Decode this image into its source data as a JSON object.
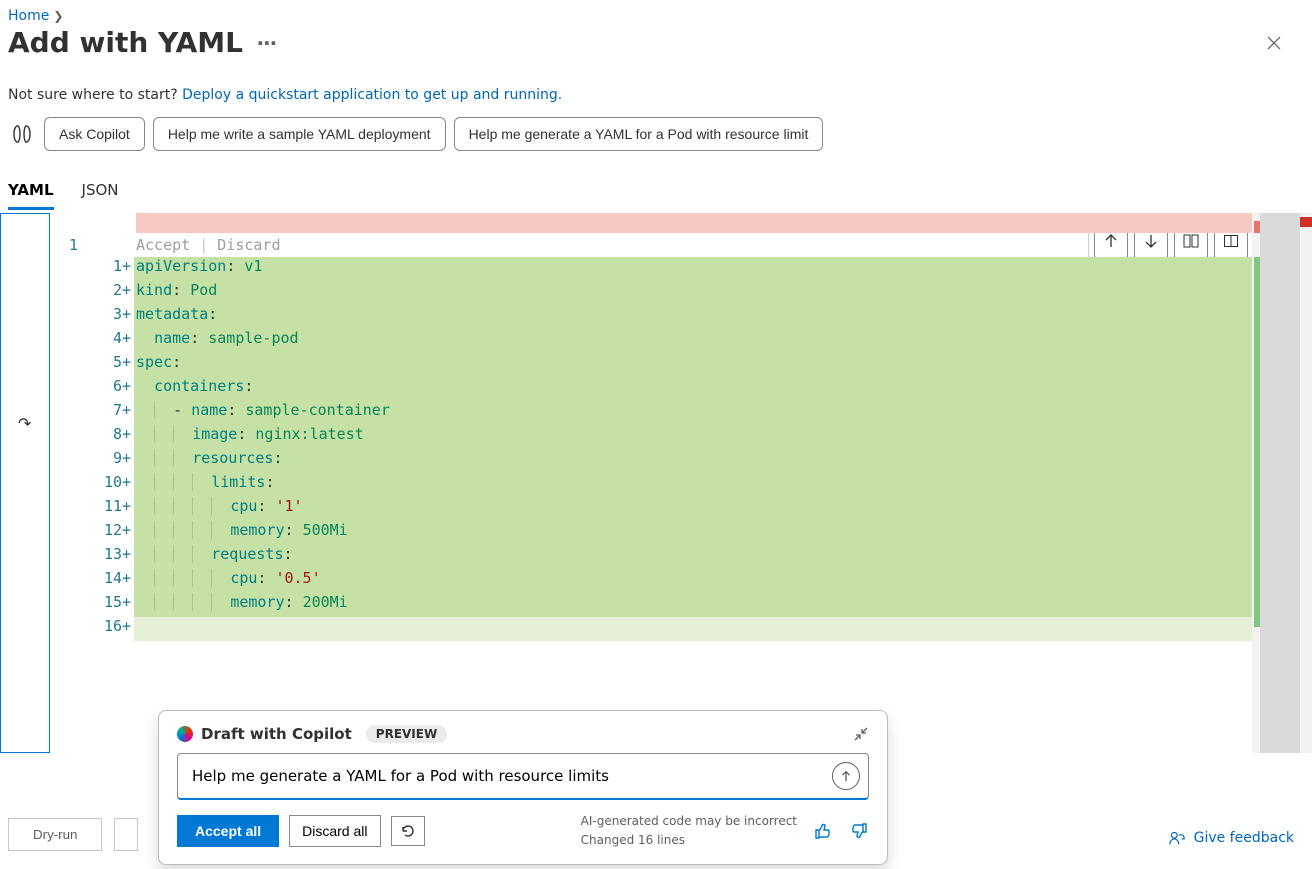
{
  "breadcrumb": {
    "home": "Home"
  },
  "page": {
    "title": "Add with YAML"
  },
  "help": {
    "prefix": "Not sure where to start? ",
    "link": "Deploy a quickstart application to get up and running."
  },
  "pills": {
    "ask": "Ask Copilot",
    "suggest1": "Help me write a sample YAML deployment",
    "suggest2": "Help me generate a YAML for a Pod with resource limit"
  },
  "tabs": {
    "yaml": "YAML",
    "json": "JSON"
  },
  "editor": {
    "original_line_no": "1",
    "inline": {
      "accept": "Accept",
      "bar": " | ",
      "discard": "Discard"
    },
    "lines": [
      {
        "n": "1",
        "tokens": [
          {
            "k": "key",
            "t": "apiVersion"
          },
          {
            "k": "punc",
            "t": ": "
          },
          {
            "k": "num",
            "t": "v1"
          }
        ]
      },
      {
        "n": "2",
        "tokens": [
          {
            "k": "key",
            "t": "kind"
          },
          {
            "k": "punc",
            "t": ": "
          },
          {
            "k": "num",
            "t": "Pod"
          }
        ]
      },
      {
        "n": "3",
        "tokens": [
          {
            "k": "key",
            "t": "metadata"
          },
          {
            "k": "punc",
            "t": ":"
          }
        ]
      },
      {
        "n": "4",
        "tokens": [
          {
            "k": "ind",
            "t": "  "
          },
          {
            "k": "key",
            "t": "name"
          },
          {
            "k": "punc",
            "t": ": "
          },
          {
            "k": "num",
            "t": "sample-pod"
          }
        ]
      },
      {
        "n": "5",
        "tokens": [
          {
            "k": "key",
            "t": "spec"
          },
          {
            "k": "punc",
            "t": ":"
          }
        ]
      },
      {
        "n": "6",
        "tokens": [
          {
            "k": "ind",
            "t": "  "
          },
          {
            "k": "key",
            "t": "containers"
          },
          {
            "k": "punc",
            "t": ":"
          }
        ]
      },
      {
        "n": "7",
        "tokens": [
          {
            "k": "ind",
            "t": "    "
          },
          {
            "k": "punc",
            "t": "- "
          },
          {
            "k": "key",
            "t": "name"
          },
          {
            "k": "punc",
            "t": ": "
          },
          {
            "k": "num",
            "t": "sample-container"
          }
        ]
      },
      {
        "n": "8",
        "tokens": [
          {
            "k": "ind",
            "t": "      "
          },
          {
            "k": "key",
            "t": "image"
          },
          {
            "k": "punc",
            "t": ": "
          },
          {
            "k": "num",
            "t": "nginx:latest"
          }
        ]
      },
      {
        "n": "9",
        "tokens": [
          {
            "k": "ind",
            "t": "      "
          },
          {
            "k": "key",
            "t": "resources"
          },
          {
            "k": "punc",
            "t": ":"
          }
        ]
      },
      {
        "n": "10",
        "tokens": [
          {
            "k": "ind",
            "t": "        "
          },
          {
            "k": "key",
            "t": "limits"
          },
          {
            "k": "punc",
            "t": ":"
          }
        ]
      },
      {
        "n": "11",
        "tokens": [
          {
            "k": "ind",
            "t": "          "
          },
          {
            "k": "key",
            "t": "cpu"
          },
          {
            "k": "punc",
            "t": ": "
          },
          {
            "k": "val",
            "t": "'1'"
          }
        ]
      },
      {
        "n": "12",
        "tokens": [
          {
            "k": "ind",
            "t": "          "
          },
          {
            "k": "key",
            "t": "memory"
          },
          {
            "k": "punc",
            "t": ": "
          },
          {
            "k": "num",
            "t": "500Mi"
          }
        ]
      },
      {
        "n": "13",
        "tokens": [
          {
            "k": "ind",
            "t": "        "
          },
          {
            "k": "key",
            "t": "requests"
          },
          {
            "k": "punc",
            "t": ":"
          }
        ]
      },
      {
        "n": "14",
        "tokens": [
          {
            "k": "ind",
            "t": "          "
          },
          {
            "k": "key",
            "t": "cpu"
          },
          {
            "k": "punc",
            "t": ": "
          },
          {
            "k": "val",
            "t": "'0.5'"
          }
        ]
      },
      {
        "n": "15",
        "tokens": [
          {
            "k": "ind",
            "t": "          "
          },
          {
            "k": "key",
            "t": "memory"
          },
          {
            "k": "punc",
            "t": ": "
          },
          {
            "k": "num",
            "t": "200Mi"
          }
        ]
      },
      {
        "n": "16",
        "tokens": [],
        "last": true
      }
    ]
  },
  "copilot": {
    "title": "Draft with Copilot",
    "badge": "PREVIEW",
    "input_value": "Help me generate a YAML for a Pod with resource limits",
    "accept": "Accept all",
    "discard": "Discard all",
    "note1": "AI-generated code may be incorrect",
    "note2": "Changed 16 lines"
  },
  "bottom": {
    "dryrun": "Dry-run"
  },
  "feedback": {
    "label": "Give feedback"
  }
}
